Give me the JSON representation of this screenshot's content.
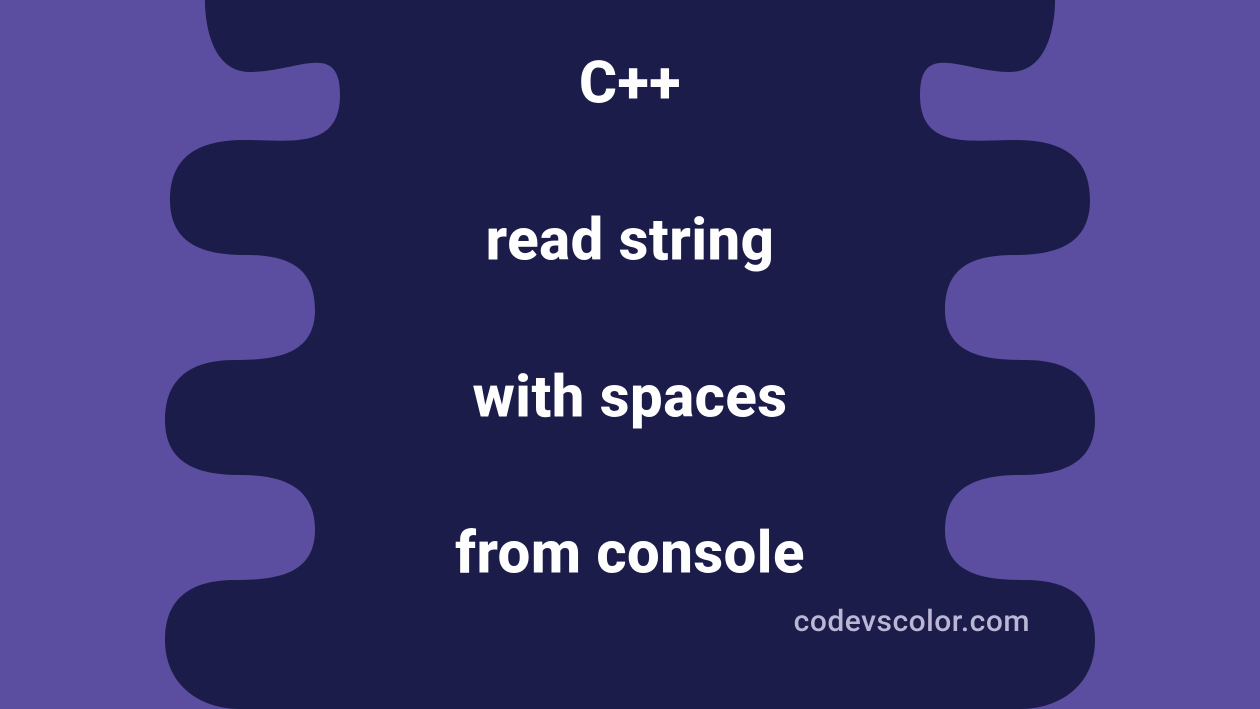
{
  "headline": {
    "line1": "C++",
    "line2": "read string",
    "line3": "with spaces",
    "line4": "from console"
  },
  "watermark": "codevscolor.com",
  "colors": {
    "background": "#5b4d9f",
    "blob": "#1b1c49",
    "text": "#fefefe",
    "watermark": "#bbb6d6"
  }
}
